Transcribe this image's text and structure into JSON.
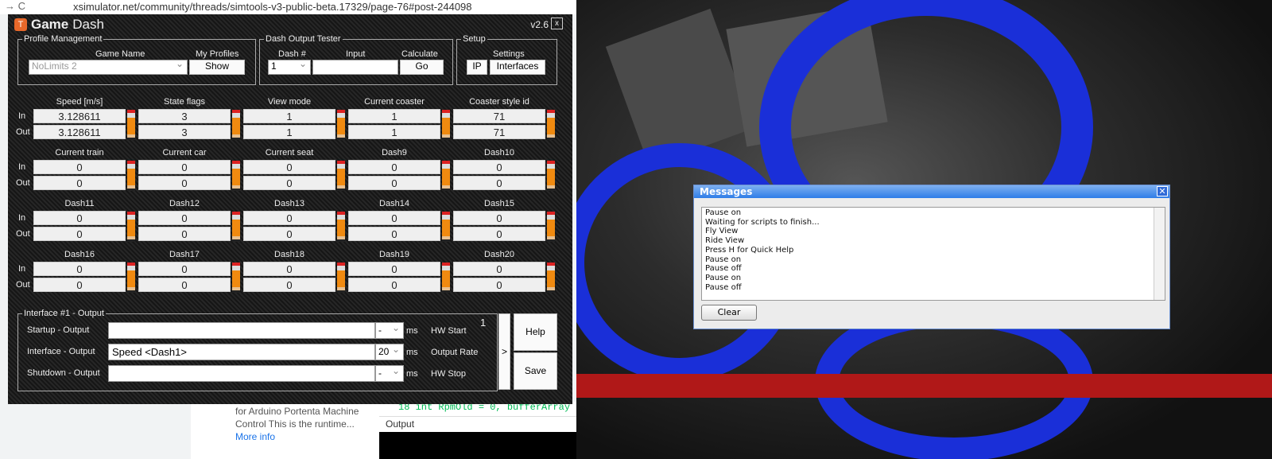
{
  "browser": {
    "url": "xsimulator.net/community/threads/simtools-v3-public-beta.17329/page-76#post-244098",
    "nav": "→ C"
  },
  "background": {
    "snippet": "for Arduino Portenta Machine Control This is the runtime...",
    "more": "More info",
    "code_line": "18   int RpmOld = 0, bufferArray",
    "output_label": "Output"
  },
  "gamedash": {
    "title_bold": "Game",
    "title_rest": "Dash",
    "version": "v2.6",
    "close": "x",
    "profile": {
      "legend": "Profile Management",
      "game_name_label": "Game Name",
      "game_name": "NoLimits 2",
      "my_profiles_label": "My Profiles",
      "show": "Show"
    },
    "tester": {
      "legend": "Dash Output Tester",
      "dash_label": "Dash #",
      "dash_value": "1",
      "input_label": "Input",
      "input_value": "",
      "calc_label": "Calculate",
      "go": "Go"
    },
    "setup": {
      "legend": "Setup",
      "settings_label": "Settings",
      "ip": "IP",
      "interfaces": "Interfaces"
    },
    "row_in": "In",
    "row_out": "Out",
    "dashes": [
      {
        "label": "Speed [m/s]",
        "in": "3.128611",
        "out": "3.128611"
      },
      {
        "label": "State flags",
        "in": "3",
        "out": "3"
      },
      {
        "label": "View mode",
        "in": "1",
        "out": "1"
      },
      {
        "label": "Current coaster",
        "in": "1",
        "out": "1"
      },
      {
        "label": "Coaster style id",
        "in": "71",
        "out": "71"
      },
      {
        "label": "Current train",
        "in": "0",
        "out": "0"
      },
      {
        "label": "Current car",
        "in": "0",
        "out": "0"
      },
      {
        "label": "Current seat",
        "in": "0",
        "out": "0"
      },
      {
        "label": "Dash9",
        "in": "0",
        "out": "0"
      },
      {
        "label": "Dash10",
        "in": "0",
        "out": "0"
      },
      {
        "label": "Dash11",
        "in": "0",
        "out": "0"
      },
      {
        "label": "Dash12",
        "in": "0",
        "out": "0"
      },
      {
        "label": "Dash13",
        "in": "0",
        "out": "0"
      },
      {
        "label": "Dash14",
        "in": "0",
        "out": "0"
      },
      {
        "label": "Dash15",
        "in": "0",
        "out": "0"
      },
      {
        "label": "Dash16",
        "in": "0",
        "out": "0"
      },
      {
        "label": "Dash17",
        "in": "0",
        "out": "0"
      },
      {
        "label": "Dash18",
        "in": "0",
        "out": "0"
      },
      {
        "label": "Dash19",
        "in": "0",
        "out": "0"
      },
      {
        "label": "Dash20",
        "in": "0",
        "out": "0"
      }
    ],
    "interface": {
      "legend": "Interface #1 - Output",
      "number": "1",
      "ms": "ms",
      "arrow": ">",
      "help": "Help",
      "save": "Save",
      "rows": [
        {
          "label": "Startup - Output",
          "value": "",
          "rate": "-",
          "hw": "HW Start"
        },
        {
          "label": "Interface - Output",
          "value": "Speed <Dash1>",
          "rate": "20",
          "hw": "Output Rate"
        },
        {
          "label": "Shutdown - Output",
          "value": "",
          "rate": "-",
          "hw": "HW Stop"
        }
      ]
    }
  },
  "messages": {
    "title": "Messages",
    "close": "✕",
    "clear": "Clear",
    "lines": [
      "Pause on",
      "Waiting for scripts to finish...",
      "Fly View",
      "Ride View",
      "Press H for Quick Help",
      "Pause on",
      "Pause off",
      "Pause on",
      "Pause off"
    ]
  }
}
